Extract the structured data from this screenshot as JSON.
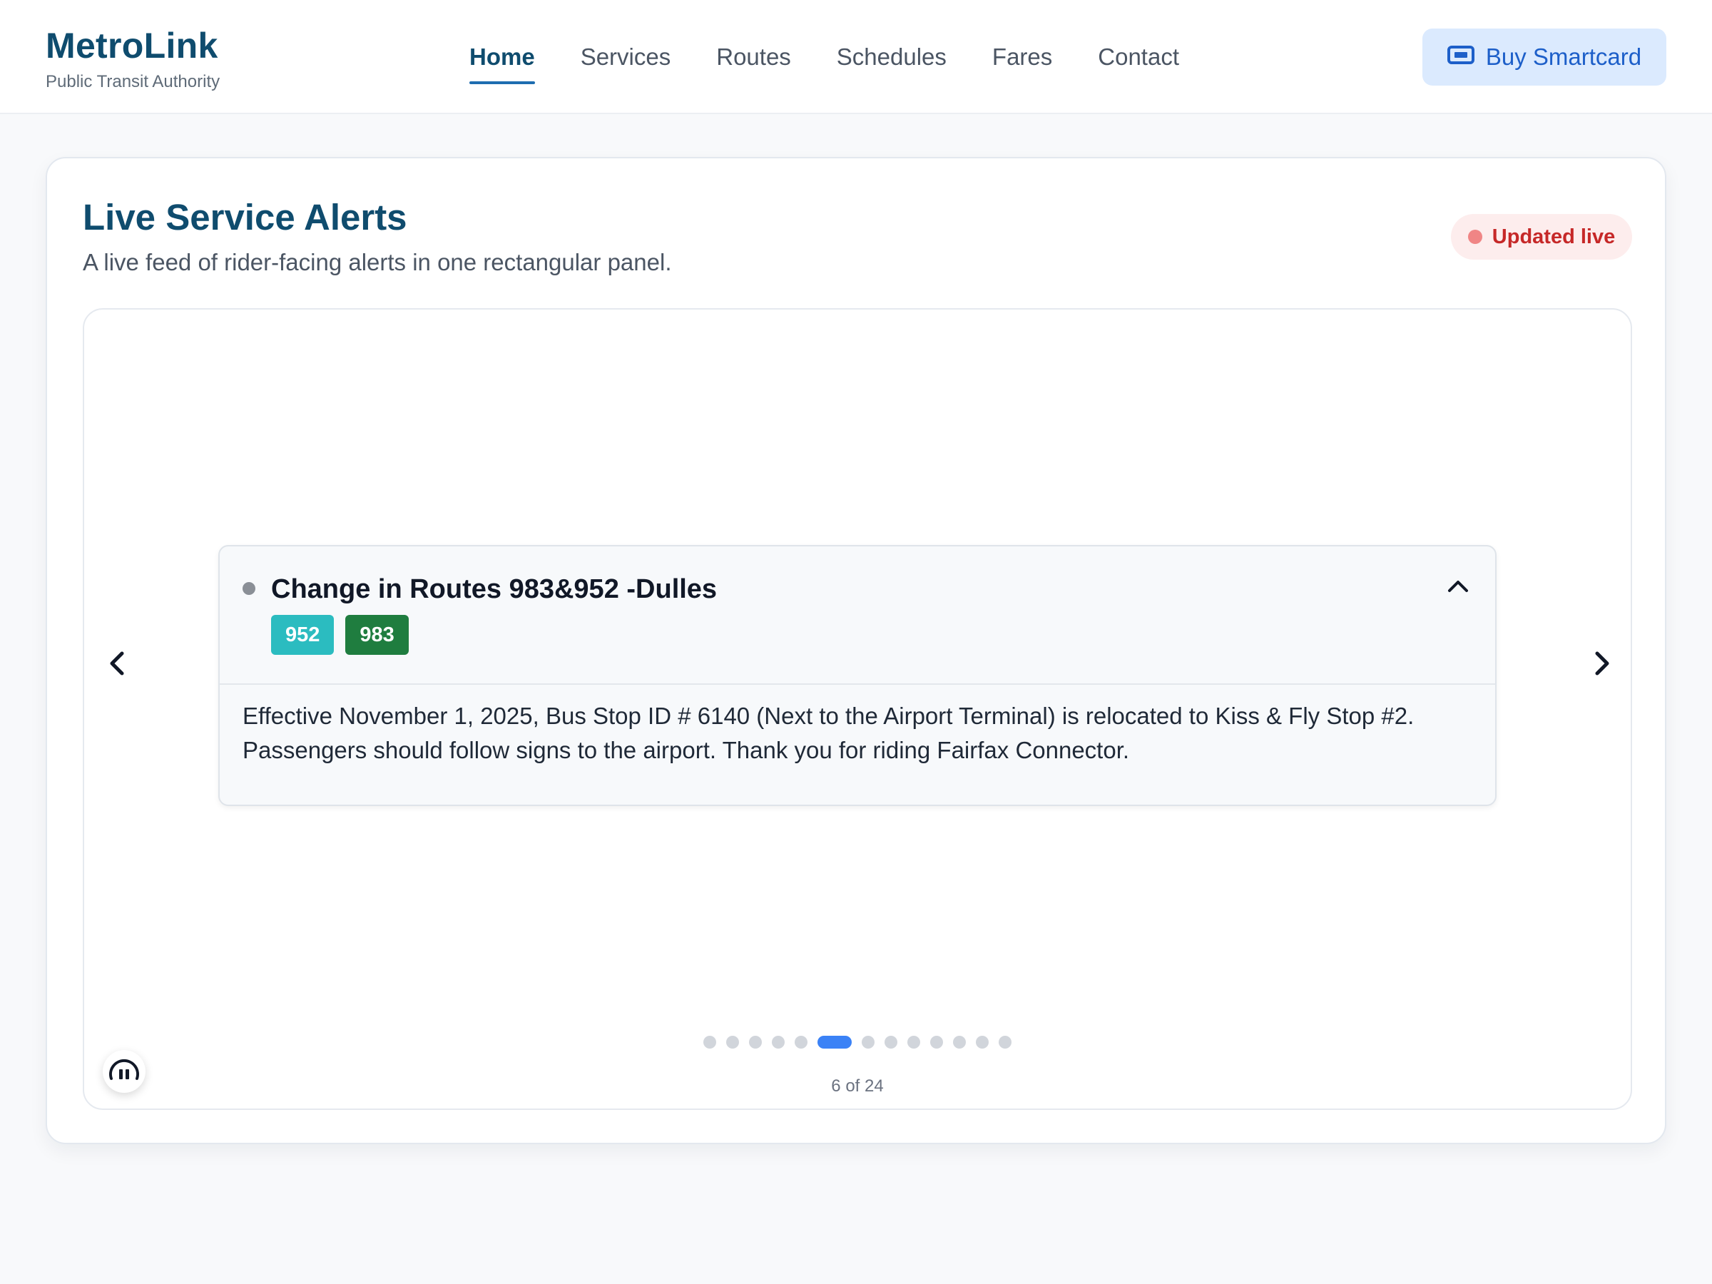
{
  "header": {
    "brand_name": "MetroLink",
    "brand_subtitle": "Public Transit Authority",
    "nav": [
      {
        "label": "Home",
        "active": true
      },
      {
        "label": "Services"
      },
      {
        "label": "Routes"
      },
      {
        "label": "Schedules"
      },
      {
        "label": "Fares"
      },
      {
        "label": "Contact"
      }
    ],
    "cta": {
      "label": "Buy Smartcard",
      "icon": "ticket-icon"
    }
  },
  "alerts_panel": {
    "title": "Live Service Alerts",
    "subtitle": "A live feed of rider-facing alerts in one rectangular panel.",
    "live_badge": "Updated live",
    "current_alert": {
      "title": "Change in Routes 983&952 -Dulles",
      "routes": [
        {
          "label": "952",
          "color": "#2bbcc0"
        },
        {
          "label": "983",
          "color": "#1f7d3f"
        }
      ],
      "body": "Effective November 1, 2025, Bus Stop ID # 6140 (Next to the Airport Terminal) is relocated to Kiss & Fly Stop #2. Passengers should follow signs to the airport. Thank you for riding Fairfax Connector.",
      "expanded": true
    },
    "pagination": {
      "dot_count": 13,
      "active_dot_index": 5,
      "counter_text": "6 of 24"
    },
    "controls": {
      "prev_icon": "chevron-left-icon",
      "next_icon": "chevron-right-icon",
      "pause_icon": "pause-icon",
      "collapse_icon": "chevron-up-icon"
    }
  },
  "colors": {
    "brand": "#0f4c6e",
    "accent": "#3b82f6",
    "live_red": "#c62828"
  }
}
